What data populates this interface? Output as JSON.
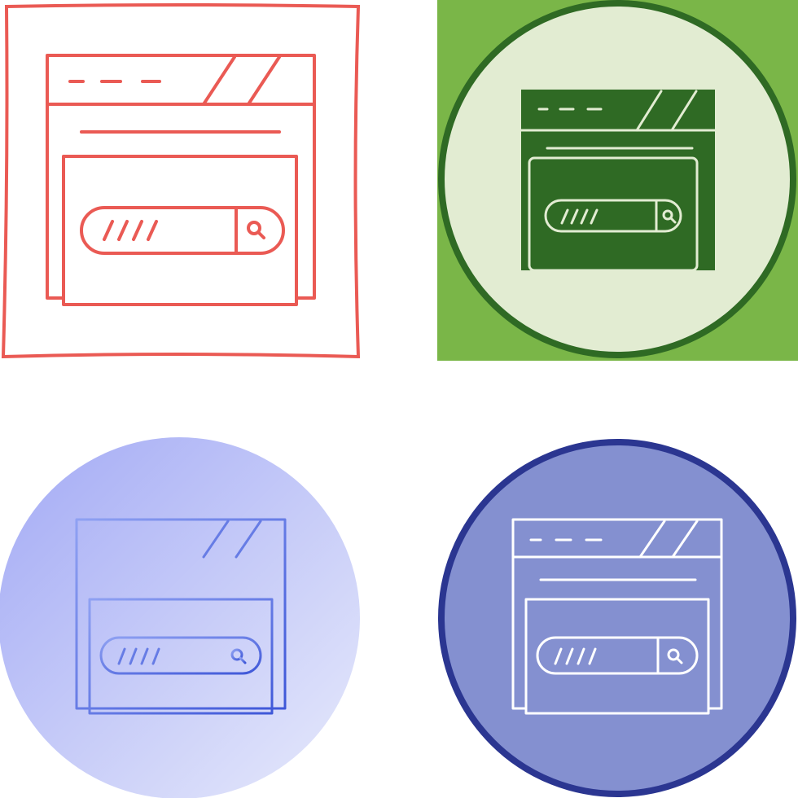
{
  "variants": [
    {
      "id": "line",
      "style": "outline",
      "background": "square",
      "stroke": "#ea5a54"
    },
    {
      "id": "glyph",
      "style": "filled",
      "background": "circle-on-square",
      "square_fill": "#7ab648",
      "circle_fill": "#e2ecd2",
      "circle_stroke": "#2f6a24",
      "fill": "#2f6a24",
      "detail": "#e2ecd2"
    },
    {
      "id": "gradient",
      "style": "gradient-outline",
      "background": "circle",
      "circle_from": "#a3aaf5",
      "circle_to": "#e7eafb",
      "stroke_from": "#8fa1f2",
      "stroke_to": "#3e57d8"
    },
    {
      "id": "flat",
      "style": "outline-on-circle",
      "background": "circle",
      "circle_fill": "#8490d0",
      "circle_stroke": "#2b3691",
      "stroke": "#ffffff"
    }
  ],
  "icon": {
    "name": "browser-search-icon"
  }
}
